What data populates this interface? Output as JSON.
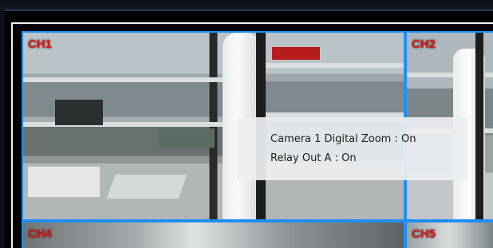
{
  "channels": [
    {
      "label": "CH1"
    },
    {
      "label": "CH2"
    },
    {
      "label": "CH4"
    },
    {
      "label": "CH5"
    }
  ],
  "osd": {
    "lines": [
      "Camera 1 Digital Zoom : On",
      "Relay Out A : On"
    ]
  },
  "colors": {
    "cell_border": "#1f8fff",
    "channel_label": "#e21b1b",
    "osd_background": "#eceef0"
  }
}
